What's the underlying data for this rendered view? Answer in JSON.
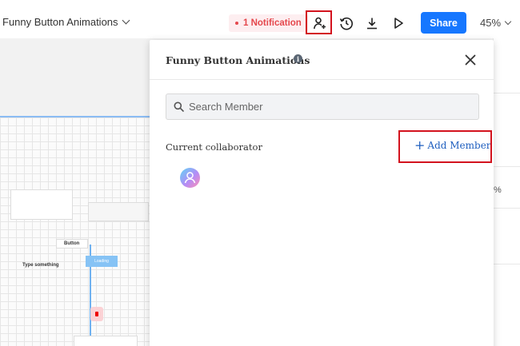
{
  "topbar": {
    "file_title": "Funny Button Animations",
    "notification": "1 Notification",
    "share_label": "Share",
    "zoom": "45%",
    "icons": [
      "add-user-icon",
      "history-icon",
      "download-icon",
      "play-icon"
    ]
  },
  "canvas": {
    "button_label": "Button",
    "input_label": "Type something",
    "loading_label": "Loading",
    "right_percent": "%"
  },
  "panel": {
    "title": "Funny Button Animations",
    "info_glyph": "i",
    "search_placeholder": "Search Member",
    "collaborator_label": "Current collaborator",
    "add_member_plus": "+",
    "add_member_label": "Add Member"
  },
  "colors": {
    "accent": "#1677ff",
    "highlight": "#d3131e",
    "notification": "#e5484d",
    "link": "#1f5fbf"
  }
}
